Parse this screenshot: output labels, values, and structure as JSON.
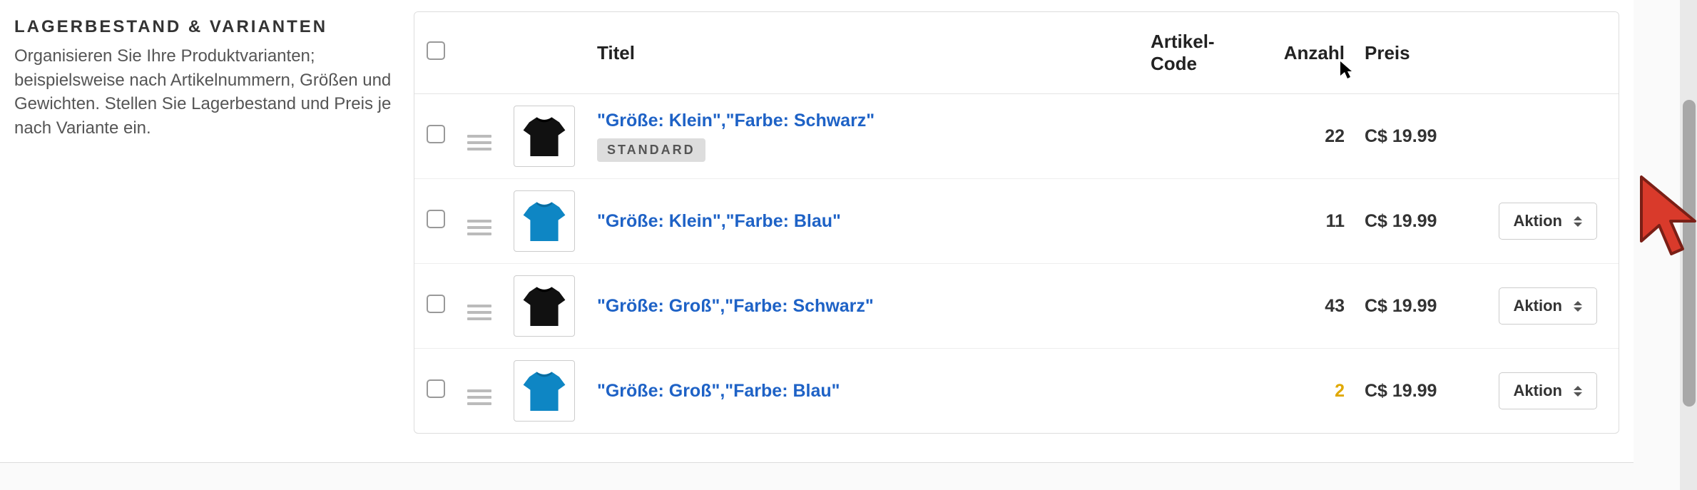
{
  "sidebar": {
    "heading": "LAGERBESTAND & VARIANTEN",
    "description": "Organisieren Sie Ihre Produktvarianten; beispielsweise nach Artikelnummern, Größen und Gewichten. Stellen Sie Lagerbestand und Preis je nach Variante ein."
  },
  "table": {
    "headers": {
      "title": "Titel",
      "code": "Artikel-Code",
      "qty": "Anzahl",
      "price": "Preis"
    },
    "action_label": "Aktion",
    "standard_badge": "STANDARD",
    "rows": [
      {
        "title": "\"Größe: Klein\",\"Farbe: Schwarz\"",
        "code": "",
        "qty": "22",
        "qty_warn": false,
        "price": "C$ 19.99",
        "is_default": true,
        "has_action": false,
        "thumb_color": "black"
      },
      {
        "title": "\"Größe: Klein\",\"Farbe: Blau\"",
        "code": "",
        "qty": "11",
        "qty_warn": false,
        "price": "C$ 19.99",
        "is_default": false,
        "has_action": true,
        "thumb_color": "blue"
      },
      {
        "title": "\"Größe: Groß\",\"Farbe: Schwarz\"",
        "code": "",
        "qty": "43",
        "qty_warn": false,
        "price": "C$ 19.99",
        "is_default": false,
        "has_action": true,
        "thumb_color": "black"
      },
      {
        "title": "\"Größe: Groß\",\"Farbe: Blau\"",
        "code": "",
        "qty": "2",
        "qty_warn": true,
        "price": "C$ 19.99",
        "is_default": false,
        "has_action": true,
        "thumb_color": "blue"
      }
    ]
  }
}
